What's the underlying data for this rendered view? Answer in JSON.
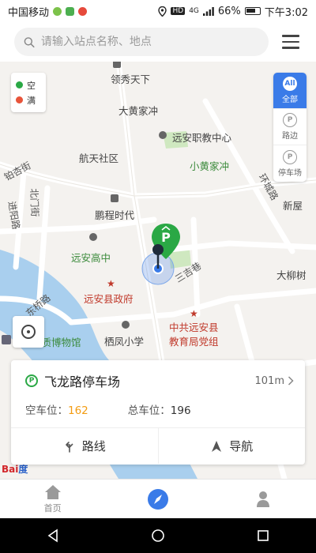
{
  "status_bar": {
    "carrier": "中国移动",
    "battery": "66%",
    "time": "下午3:02",
    "network": "HD",
    "signal": "4G"
  },
  "search": {
    "placeholder": "请输入站点名称、地点"
  },
  "legend": {
    "items": [
      {
        "label": "空",
        "color": "#2aa845"
      },
      {
        "label": "满",
        "color": "#e8543a"
      }
    ]
  },
  "filters": [
    {
      "icon": "All",
      "label": "全部",
      "active": true
    },
    {
      "icon": "P",
      "label": "路边",
      "active": false
    },
    {
      "icon": "P",
      "label": "停车场",
      "active": false
    }
  ],
  "map_labels": {
    "lingxiu": "领秀天下",
    "dahuangjia": "大黄家冲",
    "yuananzhijiao": "远安职教中心",
    "hangtian": "航天社区",
    "xiaohuangjia": "小黄家冲",
    "huanchenglu": "环城路",
    "xinwu": "新屋",
    "guixingjie": "铂杏街",
    "beimenjie": "北门街",
    "jiuguilu": "进阳路",
    "pengcheng": "鹏程时代",
    "yuangaozhong": "远安高中",
    "sanjixiang": "三吉巷",
    "daliushu": "大柳树",
    "xianzhengfu": "远安县政府",
    "dongqiaolu": "东桥路",
    "qifeng": "栖凤小学",
    "jiaoyuju1": "中共远安县",
    "jiaoyuju2": "教育局党组",
    "bowuguan": "地质博物馆"
  },
  "baidu_logo": "Bai",
  "baidu_logo_b": "度",
  "card": {
    "title": "飞龙路停车场",
    "distance": "101m",
    "free_label": "空车位：",
    "free_value": "162",
    "total_label": "总车位：",
    "total_value": "196",
    "route_label": "路线",
    "nav_label": "导航"
  },
  "bottom_nav": {
    "home": "首页"
  },
  "colors": {
    "accent": "#3a7be8",
    "parking_green": "#2aa845",
    "free_orange": "#f39c12"
  }
}
